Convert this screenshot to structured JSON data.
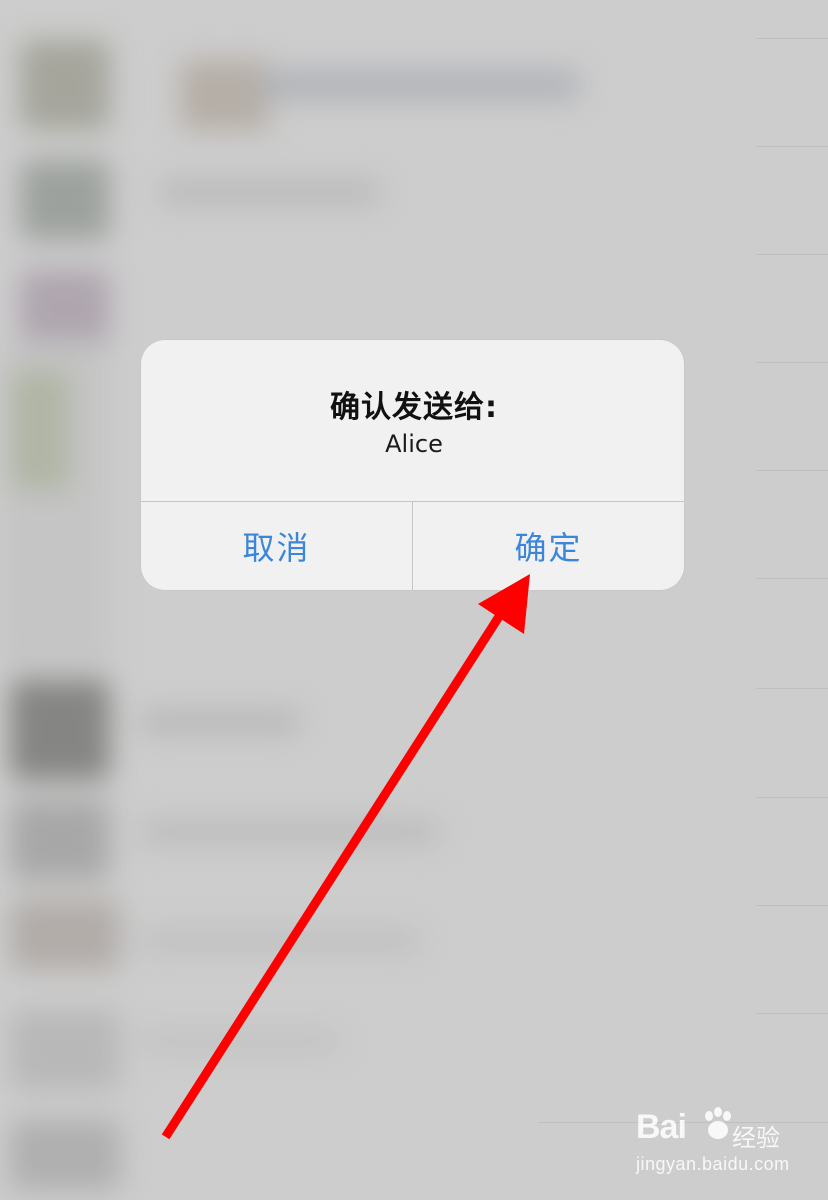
{
  "dialog": {
    "title": "确认发送给:",
    "recipient": "Alice",
    "cancel_label": "取消",
    "confirm_label": "确定"
  },
  "colors": {
    "button_text": "#3b86d9",
    "arrow": "#ff0000",
    "dialog_bg": "#f1f1f1"
  },
  "watermark": {
    "logo_text": "Bai",
    "logo_icon": "paw-icon",
    "brand_cn": "经验",
    "url": "jingyan.baidu.com"
  }
}
